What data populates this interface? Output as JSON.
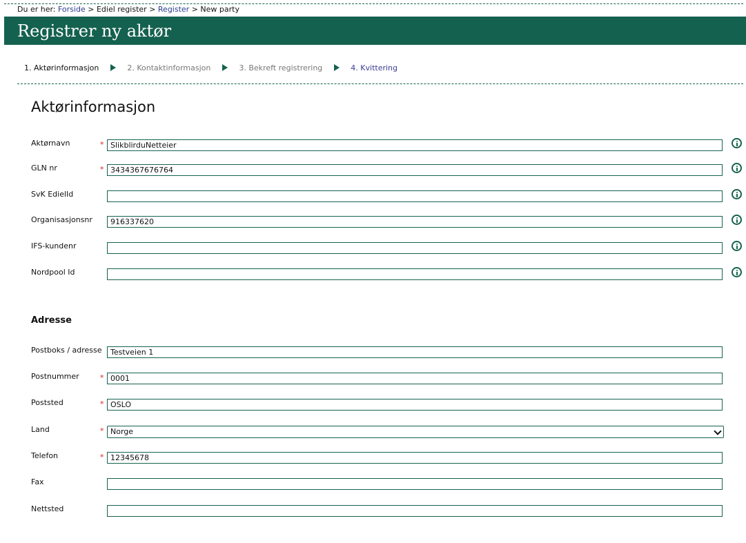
{
  "breadcrumb": {
    "prefix": "Du er her:",
    "items": [
      {
        "label": "Forside"
      },
      {
        "label": "Ediel register"
      },
      {
        "label": "Register"
      },
      {
        "label": "New party"
      }
    ],
    "separator": ">"
  },
  "header": {
    "title": "Registrer ny aktør"
  },
  "steps": [
    {
      "label": "1. Aktørinformasjon",
      "state": "current"
    },
    {
      "label": "2. Kontaktinformasjon",
      "state": "disabled"
    },
    {
      "label": "3. Bekreft registrering",
      "state": "disabled"
    },
    {
      "label": "4. Kvittering",
      "state": "link"
    }
  ],
  "section": {
    "title": "Aktørinformasjon"
  },
  "actor_fields": [
    {
      "label": "Aktørnavn",
      "required": true,
      "value": "SlikblirduNetteier"
    },
    {
      "label": "GLN nr",
      "required": true,
      "value": "3434367676764"
    },
    {
      "label": "SvK EdielId",
      "required": false,
      "value": ""
    },
    {
      "label": "Organisasjonsnr",
      "required": false,
      "value": "916337620"
    },
    {
      "label": "IFS-kundenr",
      "required": false,
      "value": ""
    },
    {
      "label": "Nordpool Id",
      "required": false,
      "value": ""
    }
  ],
  "address": {
    "title": "Adresse",
    "fields": [
      {
        "label": "Postboks / adresse",
        "required": false,
        "value": "Testveien 1"
      },
      {
        "label": "Postnummer",
        "required": true,
        "value": "0001"
      },
      {
        "label": "Poststed",
        "required": true,
        "value": "OSLO"
      },
      {
        "label": "Land",
        "required": true,
        "value": "Norge",
        "type": "select"
      },
      {
        "label": "Telefon",
        "required": true,
        "value": "12345678"
      },
      {
        "label": "Fax",
        "required": false,
        "value": ""
      },
      {
        "label": "Nettsted",
        "required": false,
        "value": ""
      }
    ]
  },
  "required_marker": "*",
  "colors": {
    "brand": "#15614f",
    "required": "#dd2222",
    "link": "#2c3c8c"
  },
  "icons": {
    "info": "info-circle-icon",
    "step_arrow": "chevron-right-icon"
  }
}
